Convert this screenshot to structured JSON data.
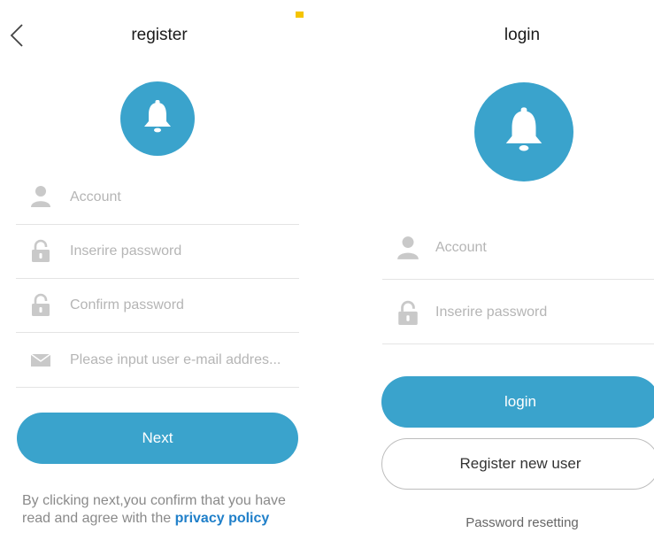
{
  "register": {
    "title": "register",
    "back_icon": "chevron-left-icon",
    "logo_icon": "bell-icon",
    "fields": {
      "account": {
        "icon": "user-icon",
        "placeholder": "Account",
        "value": ""
      },
      "password": {
        "icon": "lock-icon",
        "placeholder": "Inserire password",
        "value": ""
      },
      "confirm_password": {
        "icon": "lock-icon",
        "placeholder": "Confirm password",
        "value": ""
      },
      "email": {
        "icon": "envelope-icon",
        "placeholder": "Please input user e-mail addres...",
        "value": ""
      }
    },
    "next_label": "Next",
    "notice": {
      "text": "By clicking next,you confirm that you have read and agree with the",
      "link": "privacy policy"
    }
  },
  "login": {
    "title": "login",
    "logo_icon": "bell-icon",
    "fields": {
      "account": {
        "icon": "user-icon",
        "placeholder": "Account",
        "value": ""
      },
      "password": {
        "icon": "lock-icon",
        "placeholder": "Inserire password",
        "value": ""
      }
    },
    "login_label": "login",
    "register_label": "Register new user",
    "reset_label": "Password resetting"
  },
  "colors": {
    "accent": "#3aa3cc",
    "link": "#1f7fc9",
    "placeholder": "#b5b5b5",
    "divider": "#e4e4e4",
    "status_indicator": "#f5c400"
  }
}
